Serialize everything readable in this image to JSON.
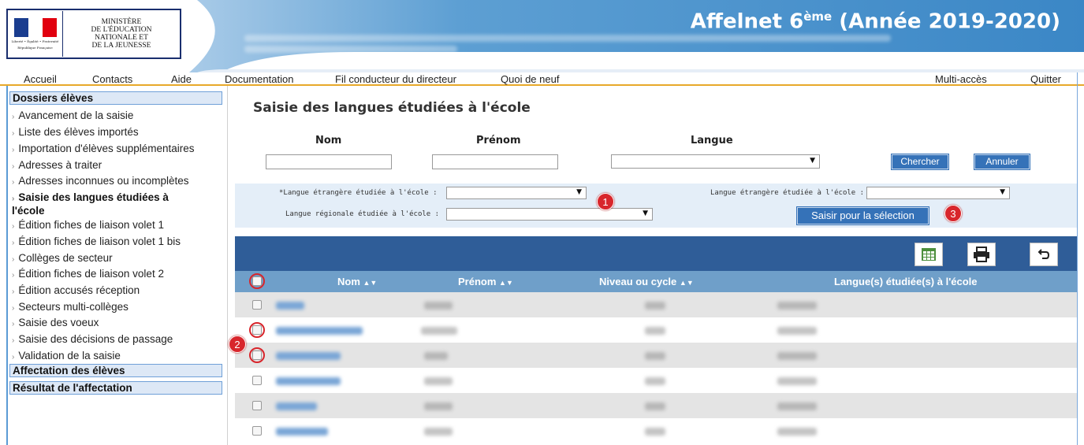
{
  "header": {
    "ministry_lines": [
      "MINISTÈRE",
      "DE L'ÉDUCATION",
      "NATIONALE ET",
      "DE LA JEUNESSE"
    ],
    "motto": "Liberté • Égalité • Fraternité",
    "republic": "République Française",
    "app_title": "Affelnet 6",
    "app_title_sup": "ème",
    "app_year": " (Année 2019-2020)",
    "colors": {
      "banner": "#3b87c6",
      "accent": "#e8a92a"
    }
  },
  "menu": {
    "accueil": "Accueil",
    "contacts": "Contacts",
    "aide": "Aide",
    "documentation": "Documentation",
    "fil": "Fil conducteur du directeur",
    "quoi": "Quoi de neuf",
    "multi": "Multi-accès",
    "quitter": "Quitter"
  },
  "sidebar": {
    "section1": "Dossiers élèves",
    "items": [
      "Avancement de la saisie",
      "Liste des élèves importés",
      "Importation d'élèves supplémentaires",
      "Adresses à traiter",
      "Adresses inconnues ou incomplètes",
      "Saisie des langues étudiées à",
      "l'école",
      "Édition fiches de liaison volet 1",
      "Édition fiches de liaison volet 1 bis",
      "Collèges de secteur",
      "Édition fiches de liaison volet 2",
      "Édition accusés réception",
      "Secteurs multi-collèges",
      "Saisie des voeux",
      "Saisie des décisions de passage",
      "Validation de la saisie"
    ],
    "section2": "Affectation des élèves",
    "section3": "Résultat de l'affectation"
  },
  "main": {
    "title": "Saisie des langues étudiées à l'école",
    "filter": {
      "nom_label": "Nom",
      "prenom_label": "Prénom",
      "langue_label": "Langue",
      "chercher": "Chercher",
      "annuler": "Annuler"
    },
    "panel": {
      "lang_etr_req": "*Langue étrangère étudiée à l'école :",
      "lang_reg": "Langue régionale étudiée à l'école :",
      "lang_etr": "Langue étrangère étudiée à l'école :",
      "saisir": "Saisir pour la sélection"
    },
    "badges": [
      "1",
      "2",
      "3"
    ],
    "table": {
      "col_nom": "Nom",
      "col_prenom": "Prénom",
      "col_niveau": "Niveau ou cycle",
      "col_langues": "Langue(s) étudiée(s) à l'école",
      "sort_glyph": "▲▼",
      "row_count": 6
    },
    "tools": [
      "grid-icon",
      "print-icon",
      "back-icon"
    ]
  }
}
